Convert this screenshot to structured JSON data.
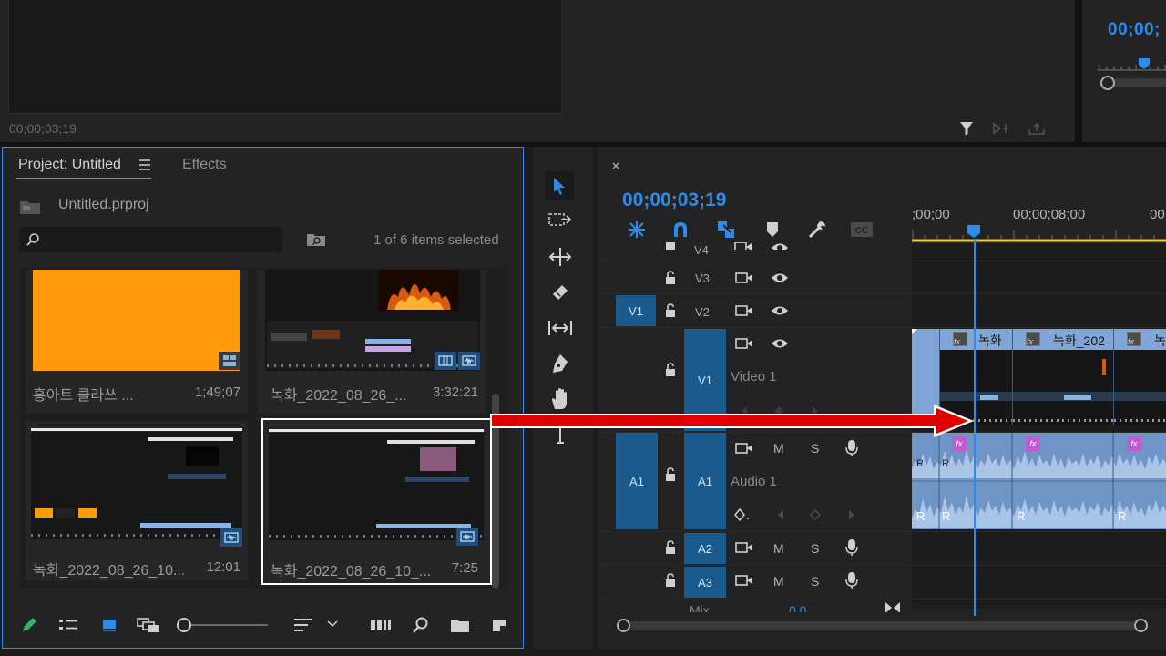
{
  "source_monitor": {
    "timecode": "00;00;03;19"
  },
  "program_monitor": {
    "timecode": "00;00;"
  },
  "project_panel": {
    "tab_project": "Project: Untitled",
    "tab_effects": "Effects",
    "project_file": "Untitled.prproj",
    "search_placeholder": "",
    "selection_count": "1 of 6 items selected",
    "items": [
      {
        "name": "홍아트 클라쓰 ...",
        "duration": "1;49;07",
        "thumb": "orange-slide",
        "selected": false
      },
      {
        "name": "녹화_2022_08_26_...",
        "duration": "3:32:21",
        "thumb": "screen-fire",
        "selected": false
      },
      {
        "name": "녹화_2022_08_26_10...",
        "duration": "12:01",
        "thumb": "screen-ui",
        "selected": false
      },
      {
        "name": "녹화_2022_08_26_10_...",
        "duration": "7:25",
        "thumb": "screen-pink",
        "selected": true
      }
    ]
  },
  "timeline": {
    "timecode": "00;00;03;19",
    "ruler_labels": [
      ";00;00",
      "00;00;08;00",
      "00"
    ],
    "tracks": {
      "v4": "V4",
      "v3": "V3",
      "v2": "V2",
      "v1_source": "V1",
      "v1": "V1",
      "v1_name": "Video 1",
      "a1_source": "A1",
      "a1": "A1",
      "a1_name": "Audio 1",
      "a2": "A2",
      "a3": "A3",
      "mix": "Mix",
      "mix_value": "0.0",
      "mute": "M",
      "solo": "S"
    },
    "clips": [
      {
        "title": "녹화"
      },
      {
        "title": "녹화_202"
      },
      {
        "title": "녹"
      }
    ],
    "fx_label": "fx",
    "r_label": "R"
  },
  "colors": {
    "accent_blue": "#2d8ceb",
    "selected_track": "#1b5a8c",
    "clip_blue": "#7fa6d6",
    "arrow_red": "#e00000",
    "playhead_yellow": "#e8d21d"
  }
}
